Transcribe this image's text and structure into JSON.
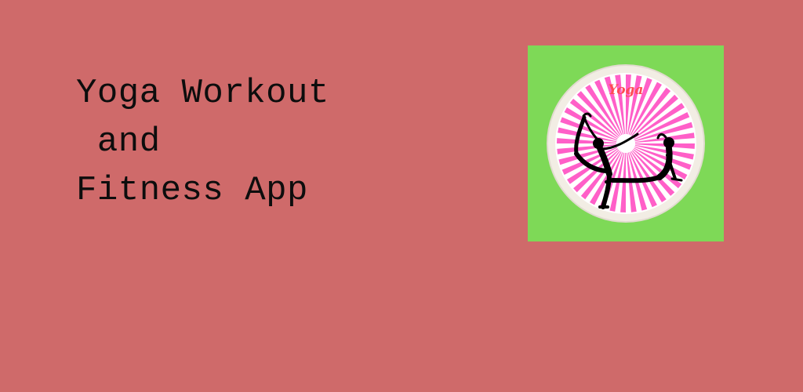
{
  "headline": {
    "line1": "Yoga Workout",
    "line2": " and",
    "line3": "Fitness App"
  },
  "icon": {
    "word": "Yoga",
    "background_color": "#7ed957",
    "ring_color": "#f2ede4",
    "ray_color": "#ff5fc8",
    "word_color": "#ff4b55",
    "figure_color": "#000000"
  },
  "page": {
    "background_color": "#cf6a6a"
  }
}
